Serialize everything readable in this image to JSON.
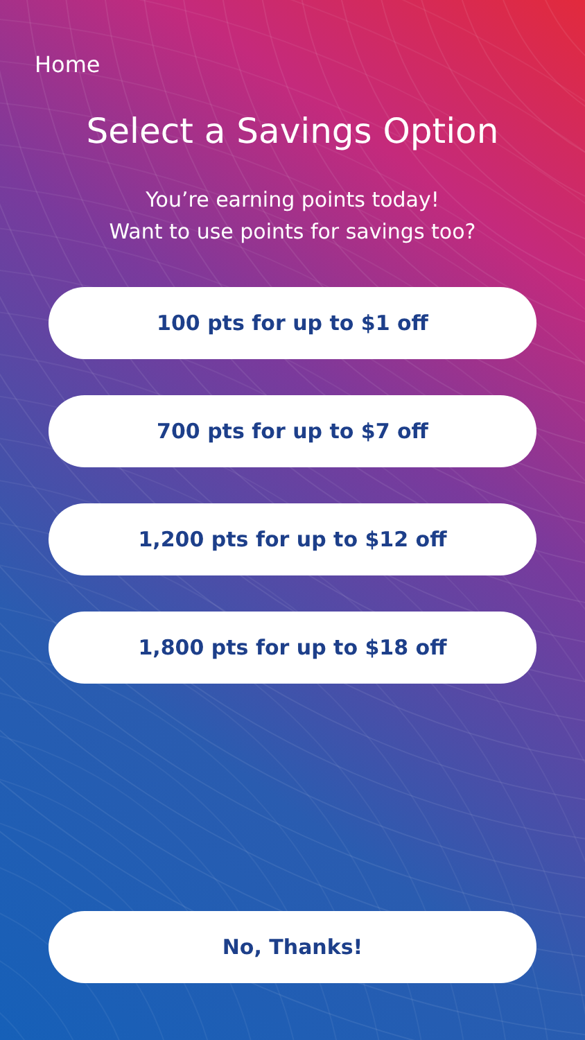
{
  "nav": {
    "back_label": "Home"
  },
  "title": "Select a Savings Option",
  "subtitle": [
    "You’re earning points today!",
    "Want to use points for savings too?"
  ],
  "options": [
    {
      "label": "100 pts for up to $1 off"
    },
    {
      "label": "700 pts for up to $7 off"
    },
    {
      "label": "1,200 pts for up to $12 off"
    },
    {
      "label": "1,800 pts for up to $18 off"
    }
  ],
  "decline_button": "No, Thanks!"
}
